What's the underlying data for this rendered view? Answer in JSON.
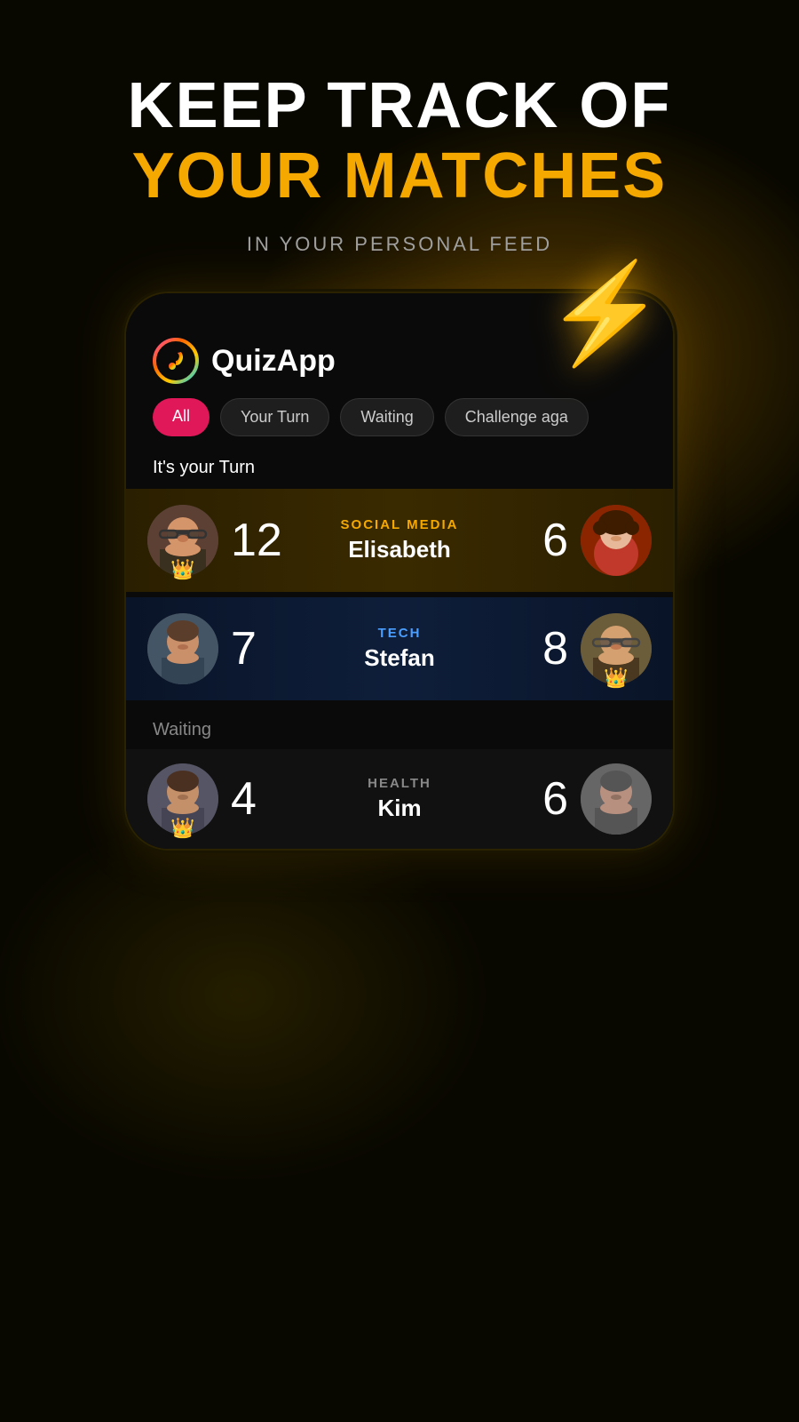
{
  "header": {
    "line1": "KEEP TRACK OF",
    "line2": "YOUR MATCHES",
    "subtitle": "IN YOUR PERSONAL FEED"
  },
  "app": {
    "name": "QuizApp"
  },
  "tabs": [
    {
      "label": "All",
      "active": true
    },
    {
      "label": "Your Turn",
      "active": false
    },
    {
      "label": "Waiting",
      "active": false
    },
    {
      "label": "Challenge aga",
      "active": false
    }
  ],
  "section_your_turn": "It's your Turn",
  "section_waiting": "Waiting",
  "matches": [
    {
      "category": "SOCIAL MEDIA",
      "opponent": "Elisabeth",
      "my_score": "12",
      "opponent_score": "6",
      "my_crown": true,
      "opponent_crown": false,
      "card_type": "gold"
    },
    {
      "category": "TECH",
      "opponent": "Stefan",
      "my_score": "7",
      "opponent_score": "8",
      "my_crown": false,
      "opponent_crown": true,
      "card_type": "blue"
    }
  ],
  "waiting_matches": [
    {
      "category": "HEALTH",
      "opponent": "Kim",
      "my_score": "4",
      "opponent_score": "6",
      "card_type": "dark"
    }
  ]
}
